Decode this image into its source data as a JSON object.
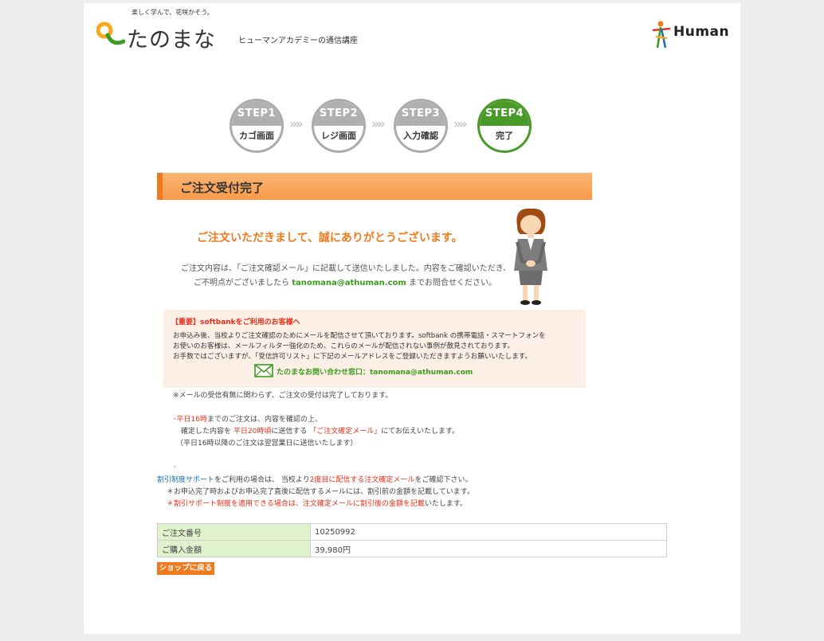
{
  "header": {
    "tagline": "楽しく学んで、花咲かそう。",
    "logo_text": "たのまな",
    "logo_sub": "ヒューマンアカデミーの通信講座",
    "partner_logo": "Human"
  },
  "steps": [
    {
      "label": "STEP1",
      "name": "カゴ画面",
      "active": false
    },
    {
      "label": "STEP2",
      "name": "レジ画面",
      "active": false
    },
    {
      "label": "STEP3",
      "name": "入力確認",
      "active": false
    },
    {
      "label": "STEP4",
      "name": "完了",
      "active": true
    }
  ],
  "step_separator": "»»",
  "title": "ご注文受付完了",
  "thanks": "ご注文いただきまして、誠にありがとうございます。",
  "intro": {
    "line1": "ご注文内容は、「ご注文確認メール」に記載して送信いたしました。内容をご確認いただき、",
    "line2_a": "ご不明点がございましたら ",
    "line2_mail": "tanomana@athuman.com",
    "line2_b": " までお問合せください。"
  },
  "notice": {
    "title": "【重要】softbankをご利用のお客様へ",
    "line1": "お申込み後、当校よりご注文確認のためにメールを配信させて頂いております。softbank の携帯電話・スマートフォンを",
    "line2": "お使いのお客様は、メールフィルター強化のため、これらのメールが配信されない事例が散見されております。",
    "line3": "お手数ではございますが、「受信許可リスト」に下記のメールアドレスをご登録いただきますようお願いいたします。",
    "contact": "たのまなお問い合わせ窓口：tanomana@athuman.com"
  },
  "notes": {
    "received": "※メールの受信有無に関わらず、ご注文の受付は完了しております。",
    "time_prefix": "･",
    "time_red": "平日16時",
    "time_rest": "までのご注文は、内容を確認の上、",
    "confirm_a": "確定した内容を ",
    "confirm_red1": "平日20時頃",
    "confirm_b": "に送信する ",
    "confirm_red2": "「ご注文確定メール」",
    "confirm_c": "にてお伝えいたします。",
    "after16": "（平日16時以降のご注文は翌営業日に送信いたします）",
    "dot": "･",
    "discount_blue": "割引制度サポート",
    "discount_a": "をご利用の場合は、 当校より",
    "discount_red": "2度目に配信する注文確定メール",
    "discount_b": "をご確認下さい。",
    "star1": "＊お申込完了時およびお申込完了直後に配信するメールには、割引前の金額を記載しています。",
    "star2_red": "＊割引サポート制度を適用できる場合は、注文確定メールに割引後の金額を記載",
    "star2_b": "いたします。"
  },
  "order": {
    "number_label": "ご注文番号",
    "number": "10250992",
    "amount_label": "ご購入金額",
    "amount": "39,980円"
  },
  "shop_button": "ショップに戻る",
  "colors": {
    "accent_orange": "#f07a1e",
    "step_active_green": "#4a9a2a",
    "mail_green": "#3c9b1e",
    "notice_red": "#e8301a"
  }
}
